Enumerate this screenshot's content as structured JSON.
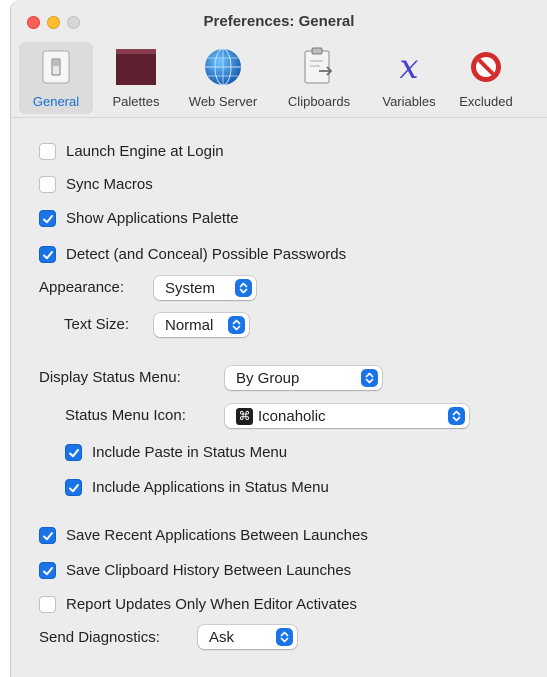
{
  "window": {
    "title": "Preferences: General"
  },
  "toolbar": {
    "tabs": [
      {
        "label": "General",
        "icon": "general-switch-icon",
        "selected": true
      },
      {
        "label": "Palettes",
        "icon": "palette-window-icon",
        "selected": false
      },
      {
        "label": "Web Server",
        "icon": "globe-icon",
        "selected": false
      },
      {
        "label": "Clipboards",
        "icon": "clipboard-icon",
        "selected": false
      },
      {
        "label": "Variables",
        "icon": "variable-x-icon",
        "selected": false
      },
      {
        "label": "Excluded",
        "icon": "prohibited-icon",
        "selected": false
      }
    ]
  },
  "settings": {
    "launch_engine": {
      "label": "Launch Engine at Login",
      "checked": false
    },
    "sync_macros": {
      "label": "Sync Macros",
      "checked": false
    },
    "show_palette": {
      "label": "Show Applications Palette",
      "checked": true
    },
    "detect_passwords": {
      "label": "Detect (and Conceal) Possible Passwords",
      "checked": true
    },
    "appearance": {
      "label": "Appearance:",
      "value": "System"
    },
    "text_size": {
      "label": "Text Size:",
      "value": "Normal"
    },
    "display_status_menu": {
      "label": "Display Status Menu:",
      "value": "By Group"
    },
    "status_menu_icon": {
      "label": "Status Menu Icon:",
      "value": "Iconaholic",
      "glyph": "⌘"
    },
    "include_paste": {
      "label": "Include Paste in Status Menu",
      "checked": true
    },
    "include_apps": {
      "label": "Include Applications in Status Menu",
      "checked": true
    },
    "save_recent_apps": {
      "label": "Save Recent Applications Between Launches",
      "checked": true
    },
    "save_clipboard": {
      "label": "Save Clipboard History Between Launches",
      "checked": true
    },
    "report_updates": {
      "label": "Report Updates Only When Editor Activates",
      "checked": false
    },
    "send_diagnostics": {
      "label": "Send Diagnostics:",
      "value": "Ask"
    }
  },
  "colors": {
    "accent": "#1a74e8",
    "selected_tab_text": "#1a6fd8"
  }
}
